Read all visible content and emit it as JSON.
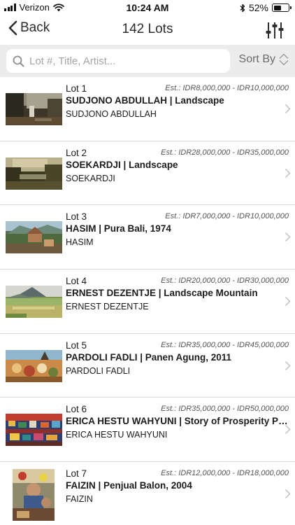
{
  "status_bar": {
    "carrier": "Verizon",
    "time": "10:24 AM",
    "battery": "52%",
    "battery_level": 0.52
  },
  "nav": {
    "back_label": "Back",
    "title": "142 Lots",
    "filter_icon": "sliders-icon"
  },
  "search": {
    "placeholder": "Lot #, Title, Artist...",
    "value": ""
  },
  "sort": {
    "label": "Sort By"
  },
  "lots": [
    {
      "lot": "Lot 1",
      "estimate": "Est.: IDR8,000,000 - IDR10,000,000",
      "title": "SUDJONO ABDULLAH | Landscape",
      "artist": "SUDJONO ABDULLAH",
      "thumbnail": "landscape painting with trees and waterfall"
    },
    {
      "lot": "Lot 2",
      "estimate": "Est.: IDR28,000,000 - IDR35,000,000",
      "title": "SOEKARDJI | Landscape",
      "artist": "SOEKARDJI",
      "thumbnail": "river landscape painting"
    },
    {
      "lot": "Lot 3",
      "estimate": "Est.: IDR7,000,000 - IDR10,000,000",
      "title": "HASIM | Pura Bali, 1974",
      "artist": "HASIM",
      "thumbnail": "Balinese temple painting"
    },
    {
      "lot": "Lot 4",
      "estimate": "Est.: IDR20,000,000 - IDR30,000,000",
      "title": "ERNEST DEZENTJE | Landscape Mountain",
      "artist": "ERNEST DEZENTJE",
      "thumbnail": "mountain landscape painting"
    },
    {
      "lot": "Lot 5",
      "estimate": "Est.: IDR35,000,000 - IDR45,000,000",
      "title": "PARDOLI FADLI | Panen Agung, 2011",
      "artist": "PARDOLI FADLI",
      "thumbnail": "harvest scene painting"
    },
    {
      "lot": "Lot 6",
      "estimate": "Est.: IDR35,000,000 - IDR50,000,000",
      "title": "ERICA HESTU WAHYUNI | Story of Prosperity Pa...",
      "artist": "ERICA HESTU WAHYUNI",
      "thumbnail": "colorful busy scene painting"
    },
    {
      "lot": "Lot 7",
      "estimate": "Est.: IDR12,000,000 - IDR18,000,000",
      "title": "FAIZIN | Penjual Balon, 2004",
      "artist": "FAIZIN",
      "thumbnail": "portrait painting of balloon seller"
    }
  ]
}
